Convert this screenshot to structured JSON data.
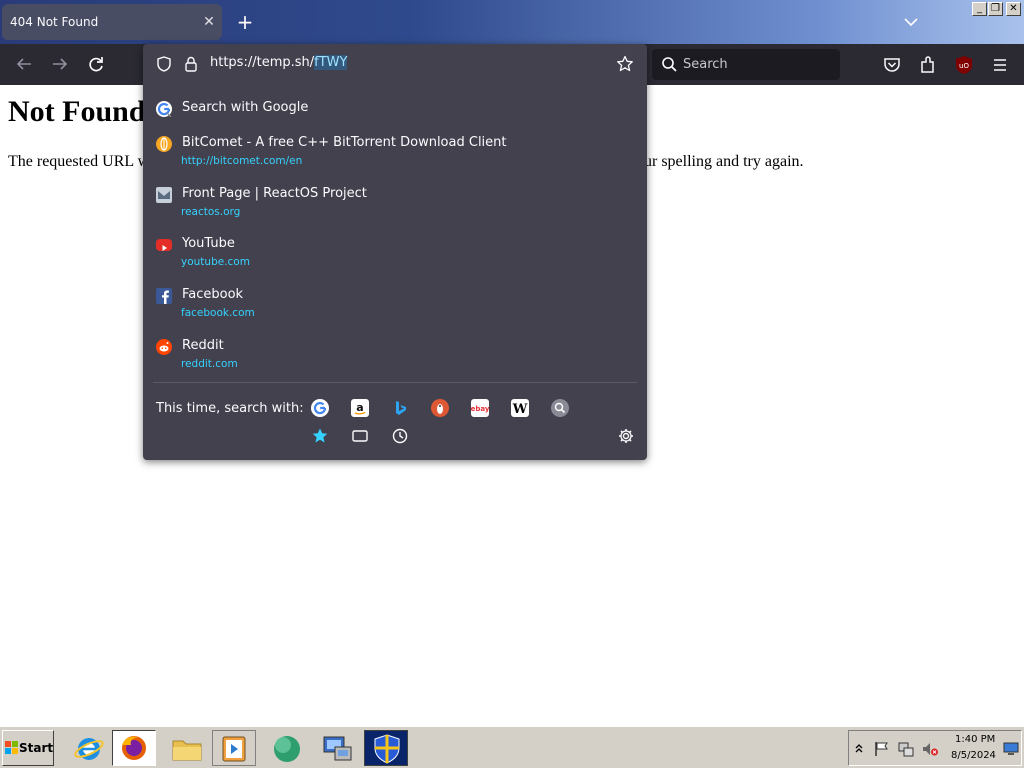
{
  "tab": {
    "title": "404 Not Found",
    "close": "✕",
    "new_tab": "+"
  },
  "window_buttons": {
    "minimize": "_",
    "restore": "❐",
    "close": "✕"
  },
  "toolbar": {
    "search_placeholder": "Search"
  },
  "urlbar": {
    "url_prefix": "https://temp.sh/",
    "url_selected": "fTWY"
  },
  "suggestions": [
    {
      "title": "Search with Google",
      "url": ""
    },
    {
      "title": "BitComet - A free C++ BitTorrent Download Client",
      "url": "http://bitcomet.com/en"
    },
    {
      "title": "Front Page | ReactOS Project",
      "url": "reactos.org"
    },
    {
      "title": "YouTube",
      "url": "youtube.com"
    },
    {
      "title": "Facebook",
      "url": "facebook.com"
    },
    {
      "title": "Reddit",
      "url": "reddit.com"
    }
  ],
  "oneoff": {
    "label": "This time, search with:"
  },
  "page": {
    "heading": "Not Found",
    "paragraph_start": "The requested URL w",
    "paragraph_end": "ur spelling and try again."
  },
  "taskbar": {
    "start_label": "Start",
    "time": "1:40 PM",
    "date": "8/5/2024"
  },
  "colors": {
    "accent": "#35d2ff",
    "panel": "#42414d",
    "toolbar": "#2b2a33"
  }
}
